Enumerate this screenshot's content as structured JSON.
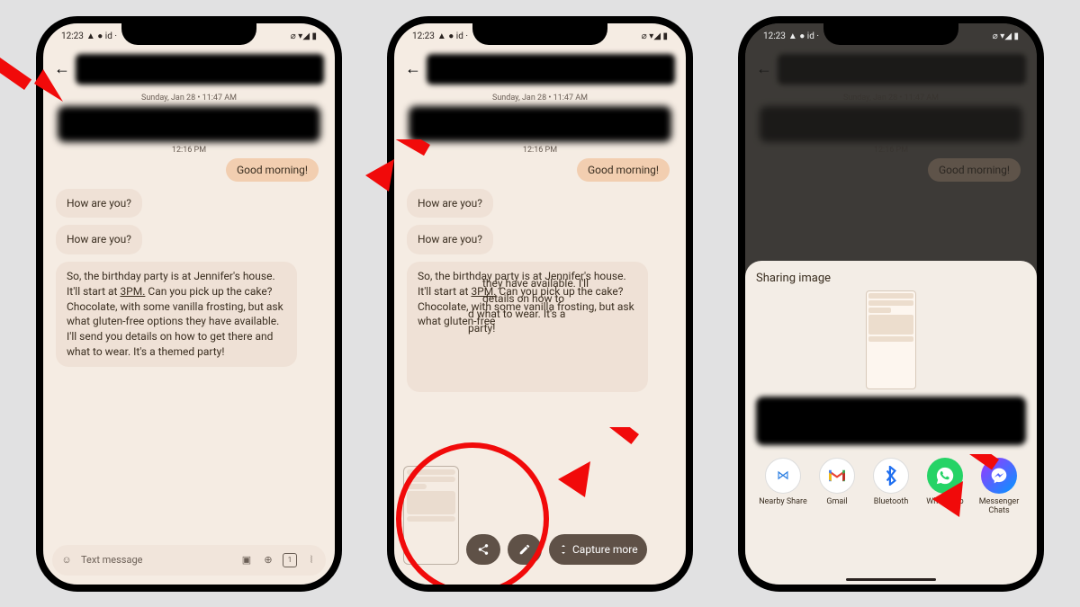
{
  "status": {
    "time": "12:23",
    "indicators": "▲ ● id ·",
    "right": "⌀ ▾◢ ▮"
  },
  "chat": {
    "ts1": "Sunday, Jan 28 • 11:47 AM",
    "ts2": "12:16 PM",
    "out1": "Good morning!",
    "in1": "How are you?",
    "in2": "How are you?",
    "in3_pre": "So, the birthday party is at Jennifer's house. It'll start at ",
    "in3_time": "3PM.",
    "in3_post": " Can you pick up the cake? Chocolate, with some vanilla frosting, but ask what gluten-free options they have available. I'll send you details on how to get there and what to wear.  It's a themed party!",
    "in3_post_short": " Can you pick up the cake? Chocolate, with some vanilla frosting, but ask what gluten-free",
    "in3_post_tail1": "they have available. I'll",
    "in3_post_tail2": "details on how to",
    "in3_post_tail3": "d what to wear.  It's a",
    "in3_post_tail4": "party!"
  },
  "compose": {
    "placeholder": "Text message"
  },
  "toolbar": {
    "capture_more": "Capture more"
  },
  "share": {
    "title": "Sharing image",
    "apps": [
      {
        "label": "Nearby Share"
      },
      {
        "label": "Gmail"
      },
      {
        "label": "Bluetooth"
      },
      {
        "label": "WhatsApp"
      },
      {
        "label": "Messenger Chats"
      }
    ]
  }
}
